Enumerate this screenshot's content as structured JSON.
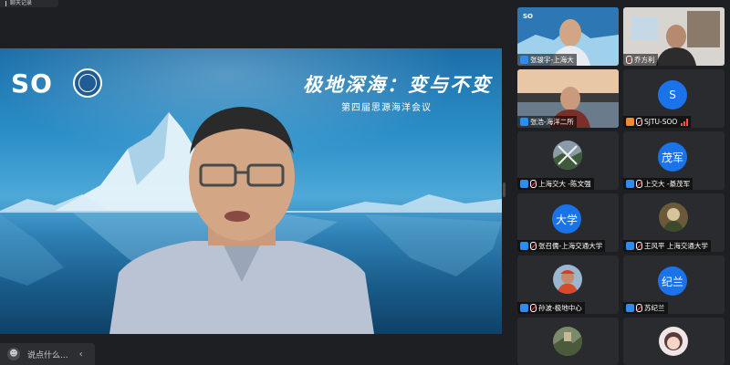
{
  "window": {
    "top_chip_label": "聊天记录"
  },
  "main": {
    "logo_text": "SO",
    "conference_title": "极地深海：变与不变",
    "conference_subtitle": "第四届思源海洋会议"
  },
  "chat": {
    "placeholder": "说点什么...",
    "collapse_glyph": "‹",
    "emoji_glyph": "☻"
  },
  "participants": [
    {
      "name": "张骏宇-上海大",
      "kind": "video",
      "mic_muted": false,
      "icon": "person-icon"
    },
    {
      "name": "乔方利",
      "kind": "video",
      "mic_muted": true,
      "icon": "person-icon"
    },
    {
      "name": "张浩-海洋二所",
      "kind": "video",
      "mic_muted": false,
      "icon": "person-icon"
    },
    {
      "name": "SJTU-SOO",
      "kind": "avatar-letter",
      "avatar_text": "S",
      "mic_muted": true,
      "orange_icon": true,
      "icon": "person-icon"
    },
    {
      "name": "上海交大 -陈文强",
      "kind": "avatar-photo",
      "mic_muted": true,
      "icon": "person-icon"
    },
    {
      "name": "上交大 -綦茂军",
      "kind": "avatar-letter",
      "avatar_text": "茂军",
      "mic_muted": true,
      "icon": "person-icon"
    },
    {
      "name": "张召儒-上海交通大学",
      "kind": "avatar-letter",
      "avatar_text": "大学",
      "mic_muted": true,
      "icon": "person-icon"
    },
    {
      "name": "王风平 上海交通大学",
      "kind": "avatar-photo",
      "mic_muted": true,
      "icon": "person-icon"
    },
    {
      "name": "孙波-极地中心",
      "kind": "avatar-photo",
      "mic_muted": true,
      "icon": "person-icon"
    },
    {
      "name": "苏纪兰",
      "kind": "avatar-letter",
      "avatar_text": "纪兰",
      "mic_muted": true,
      "icon": "person-icon"
    },
    {
      "name": "",
      "kind": "avatar-photo",
      "mic_muted": true,
      "icon": "person-icon"
    },
    {
      "name": "",
      "kind": "avatar-photo",
      "mic_muted": true,
      "icon": "person-icon"
    }
  ],
  "colors": {
    "accent_blue": "#1a73e8",
    "muted_red": "#ff4d4f",
    "panel_bg": "#1e1f22"
  }
}
